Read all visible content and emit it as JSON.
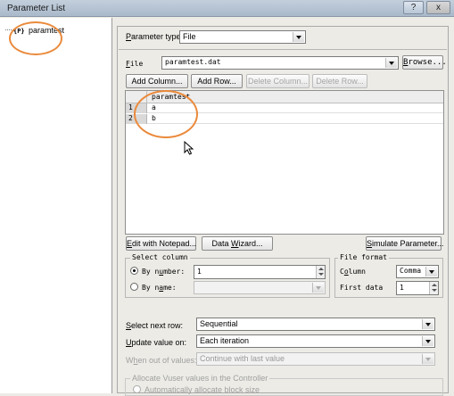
{
  "window": {
    "title": "Parameter List",
    "help_button": "?",
    "close_button": "x"
  },
  "tree": {
    "items": [
      {
        "label": "paramtest",
        "icon": "parameter-icon"
      }
    ]
  },
  "parameter_type": {
    "label": "Parameter type:",
    "value": "File"
  },
  "file": {
    "label": "File",
    "value": "paramtest.dat",
    "browse_label": "Browse..."
  },
  "table_buttons": {
    "add_column": "Add Column...",
    "add_row": "Add Row...",
    "delete_column": "Delete Column...",
    "delete_row": "Delete Row..."
  },
  "grid": {
    "column_header": "paramtest",
    "rows": [
      {
        "num": "1",
        "value": "a"
      },
      {
        "num": "2",
        "value": "b"
      }
    ]
  },
  "action_buttons": {
    "edit_notepad": "Edit with Notepad...",
    "data_wizard": "Data Wizard...",
    "simulate": "Simulate Parameter..."
  },
  "select_column": {
    "title": "Select column",
    "by_number_label": "By number:",
    "by_number_value": "1",
    "by_number_selected": true,
    "by_name_label": "By name:",
    "by_name_value": ""
  },
  "file_format": {
    "title": "File format",
    "column_label": "Column",
    "column_value": "Comma",
    "first_data_label": "First data",
    "first_data_value": "1"
  },
  "select_next_row": {
    "label": "Select next row:",
    "value": "Sequential"
  },
  "update_value_on": {
    "label": "Update value on:",
    "value": "Each iteration"
  },
  "when_out_of_values": {
    "label": "When out of values:",
    "value": "Continue with last value"
  },
  "allocate": {
    "title": "Allocate Vuser values in the Controller",
    "auto_label": "Automatically allocate block size"
  },
  "colors": {
    "annotation_orange": "#ea8a3c",
    "title_bar": "#b5c3d3",
    "dialog_bg": "#ecebe6"
  }
}
